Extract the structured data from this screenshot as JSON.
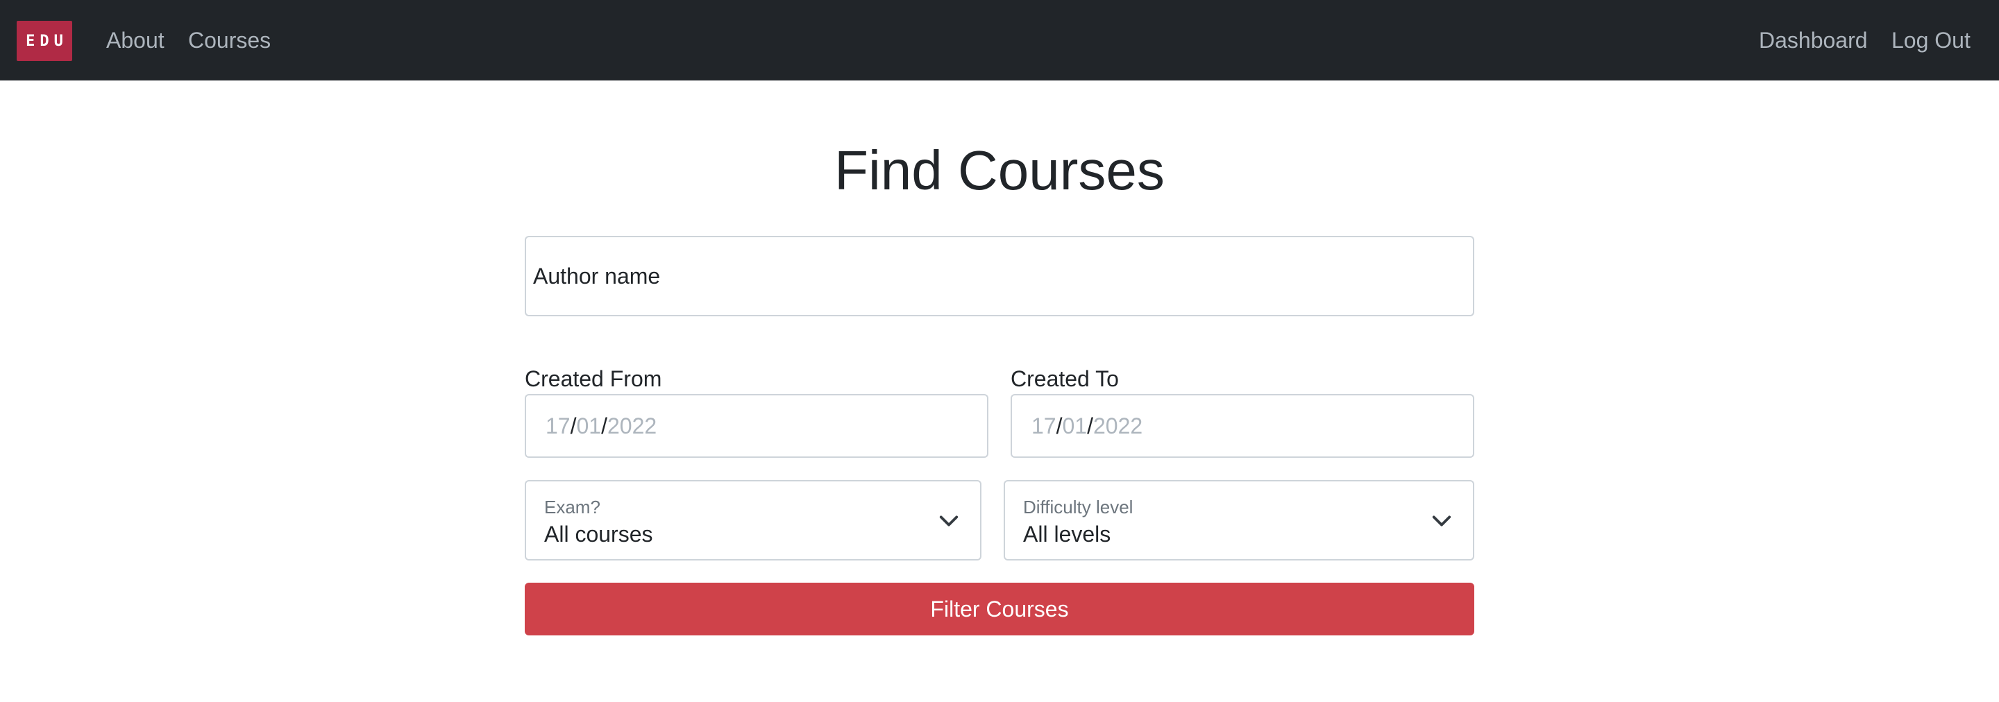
{
  "navbar": {
    "brand": "EDU",
    "links": [
      {
        "label": "About"
      },
      {
        "label": "Courses"
      }
    ],
    "right_links": [
      {
        "label": "Dashboard"
      },
      {
        "label": "Log Out"
      }
    ]
  },
  "main": {
    "title": "Find Courses",
    "author_input": {
      "placeholder": "Author name",
      "value": ""
    },
    "created_from": {
      "label": "Created From",
      "day": "17",
      "month": "01",
      "year": "2022",
      "separator": "/"
    },
    "created_to": {
      "label": "Created To",
      "day": "17",
      "month": "01",
      "year": "2022",
      "separator": "/"
    },
    "exam_select": {
      "label": "Exam?",
      "value": "All courses"
    },
    "level_select": {
      "label": "Difficulty level",
      "value": "All levels"
    },
    "filter_button": {
      "label": "Filter Courses"
    }
  },
  "colors": {
    "navbar_bg": "#212529",
    "brand_bg": "#b02a45",
    "button_bg": "#cf424a",
    "nav_link": "#adb5bd"
  },
  "icons": {
    "select_chevron": "chevron-down-icon"
  }
}
